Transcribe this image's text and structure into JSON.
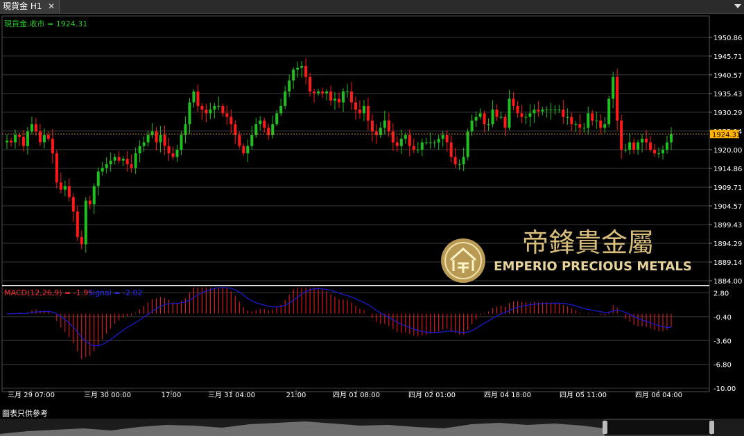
{
  "tab": {
    "title": "現貨金 H1",
    "close": "✕"
  },
  "footer_note": "圖表只供參考",
  "logo": {
    "en": "EMPERIO PRECIOUS METALS",
    "zh": "帝鋒貴金屬"
  },
  "indicators": {
    "price_label": "現貨金.收市 = 1924.31",
    "macd_label": "MACD(12,26,9) = -1.95",
    "signal_label": "Signal = -2.02"
  },
  "colors": {
    "up": "#1fbf1f",
    "down": "#ff1a1a",
    "grid": "#3a3a3a",
    "signal": "#1a1acc",
    "price_line": "#d8a020",
    "label_green": "#22cc22"
  },
  "chart_data": [
    {
      "type": "candlestick",
      "title": "現貨金 H1",
      "current_price": "1924.31",
      "ylim": [
        1884.0,
        1953.5
      ],
      "y_ticks": [
        "1950.86",
        "1945.71",
        "1940.57",
        "1935.43",
        "1930.29",
        "1925.14",
        "1920.00",
        "1914.86",
        "1909.71",
        "1904.57",
        "1899.43",
        "1894.29",
        "1889.14",
        "1884.00"
      ],
      "x_ticks": [
        "三月 29 07:00",
        "三月 30 00:00",
        "17:00",
        "三月 31 04:00",
        "21:00",
        "四月 01 08:00",
        "四月 02 01:00",
        "四月 04 18:00",
        "四月 05 11:00",
        "四月 06 04:00"
      ],
      "closes": [
        1922.5,
        1922.0,
        1924.0,
        1923.5,
        1921.0,
        1925.0,
        1927.0,
        1925.0,
        1922.0,
        1924.0,
        1923.0,
        1919.0,
        1911.0,
        1909.0,
        1910.0,
        1907.0,
        1903.0,
        1896.0,
        1894.0,
        1906.0,
        1905.0,
        1910.0,
        1914.0,
        1915.0,
        1916.0,
        1917.0,
        1918.0,
        1917.0,
        1917.5,
        1916.0,
        1915.0,
        1919.0,
        1921.0,
        1922.0,
        1924.0,
        1925.0,
        1922.0,
        1924.0,
        1921.0,
        1919.0,
        1918.0,
        1920.0,
        1924.0,
        1927.0,
        1933.0,
        1936.0,
        1932.0,
        1931.0,
        1930.0,
        1931.0,
        1932.0,
        1932.0,
        1930.0,
        1929.0,
        1927.0,
        1924.0,
        1921.0,
        1919.0,
        1921.0,
        1924.0,
        1927.0,
        1928.0,
        1926.0,
        1924.0,
        1927.0,
        1930.0,
        1932.0,
        1936.0,
        1939.0,
        1942.0,
        1942.5,
        1943.0,
        1940.0,
        1936.0,
        1935.5,
        1936.0,
        1935.5,
        1936.0,
        1933.5,
        1934.0,
        1933.0,
        1936.0,
        1936.0,
        1933.0,
        1931.0,
        1930.0,
        1932.0,
        1928.0,
        1925.0,
        1924.0,
        1926.0,
        1928.0,
        1925.0,
        1922.0,
        1921.0,
        1923.0,
        1924.0,
        1921.0,
        1920.0,
        1920.0,
        1922.0,
        1922.0,
        1922.0,
        1922.0,
        1923.0,
        1924.0,
        1922.0,
        1918.0,
        1916.0,
        1916.0,
        1918.0,
        1925.0,
        1928.0,
        1929.0,
        1930.0,
        1927.0,
        1927.0,
        1931.0,
        1929.0,
        1929.0,
        1926.0,
        1934.0,
        1932.0,
        1930.0,
        1929.0,
        1929.0,
        1930.0,
        1931.0,
        1930.5,
        1931.0,
        1931.0,
        1931.0,
        1931.0,
        1931.0,
        1929.0,
        1929.0,
        1927.0,
        1927.0,
        1926.0,
        1926.0,
        1930.0,
        1928.0,
        1928.0,
        1926.0,
        1927.0,
        1934.0,
        1940.0,
        1928.0,
        1920.0,
        1920.0,
        1922.0,
        1920.0,
        1922.0,
        1923.0,
        1922.0,
        1920.0,
        1919.0,
        1919.0,
        1920.0,
        1922.0,
        1924.31
      ],
      "macd": {
        "ylim": [
          -10.0,
          3.5
        ],
        "y_ticks": [
          "2.80",
          "-0.40",
          "-3.60",
          "-6.80",
          "-10.00"
        ],
        "macd": -1.95,
        "signal": -2.02
      }
    }
  ]
}
